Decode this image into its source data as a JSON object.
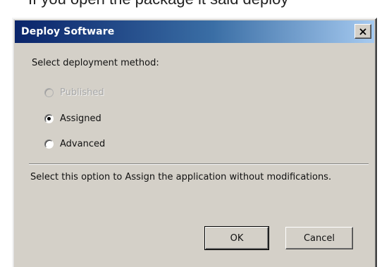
{
  "background": {
    "partial_text": "If you open the package it said deploy"
  },
  "dialog": {
    "title": "Deploy Software",
    "close_glyph": "X",
    "prompt": "Select deployment method:",
    "options": [
      {
        "label": "Published",
        "enabled": false,
        "selected": false
      },
      {
        "label": "Assigned",
        "enabled": true,
        "selected": true
      },
      {
        "label": "Advanced",
        "enabled": true,
        "selected": false
      }
    ],
    "description": "Select this option to Assign the application without modifications.",
    "buttons": {
      "ok": "OK",
      "cancel": "Cancel"
    }
  },
  "colors": {
    "title_gradient_start": "#0a246a",
    "title_gradient_end": "#a6caf0",
    "face": "#d4d0c8"
  },
  "icons": {
    "close": "close-icon"
  }
}
